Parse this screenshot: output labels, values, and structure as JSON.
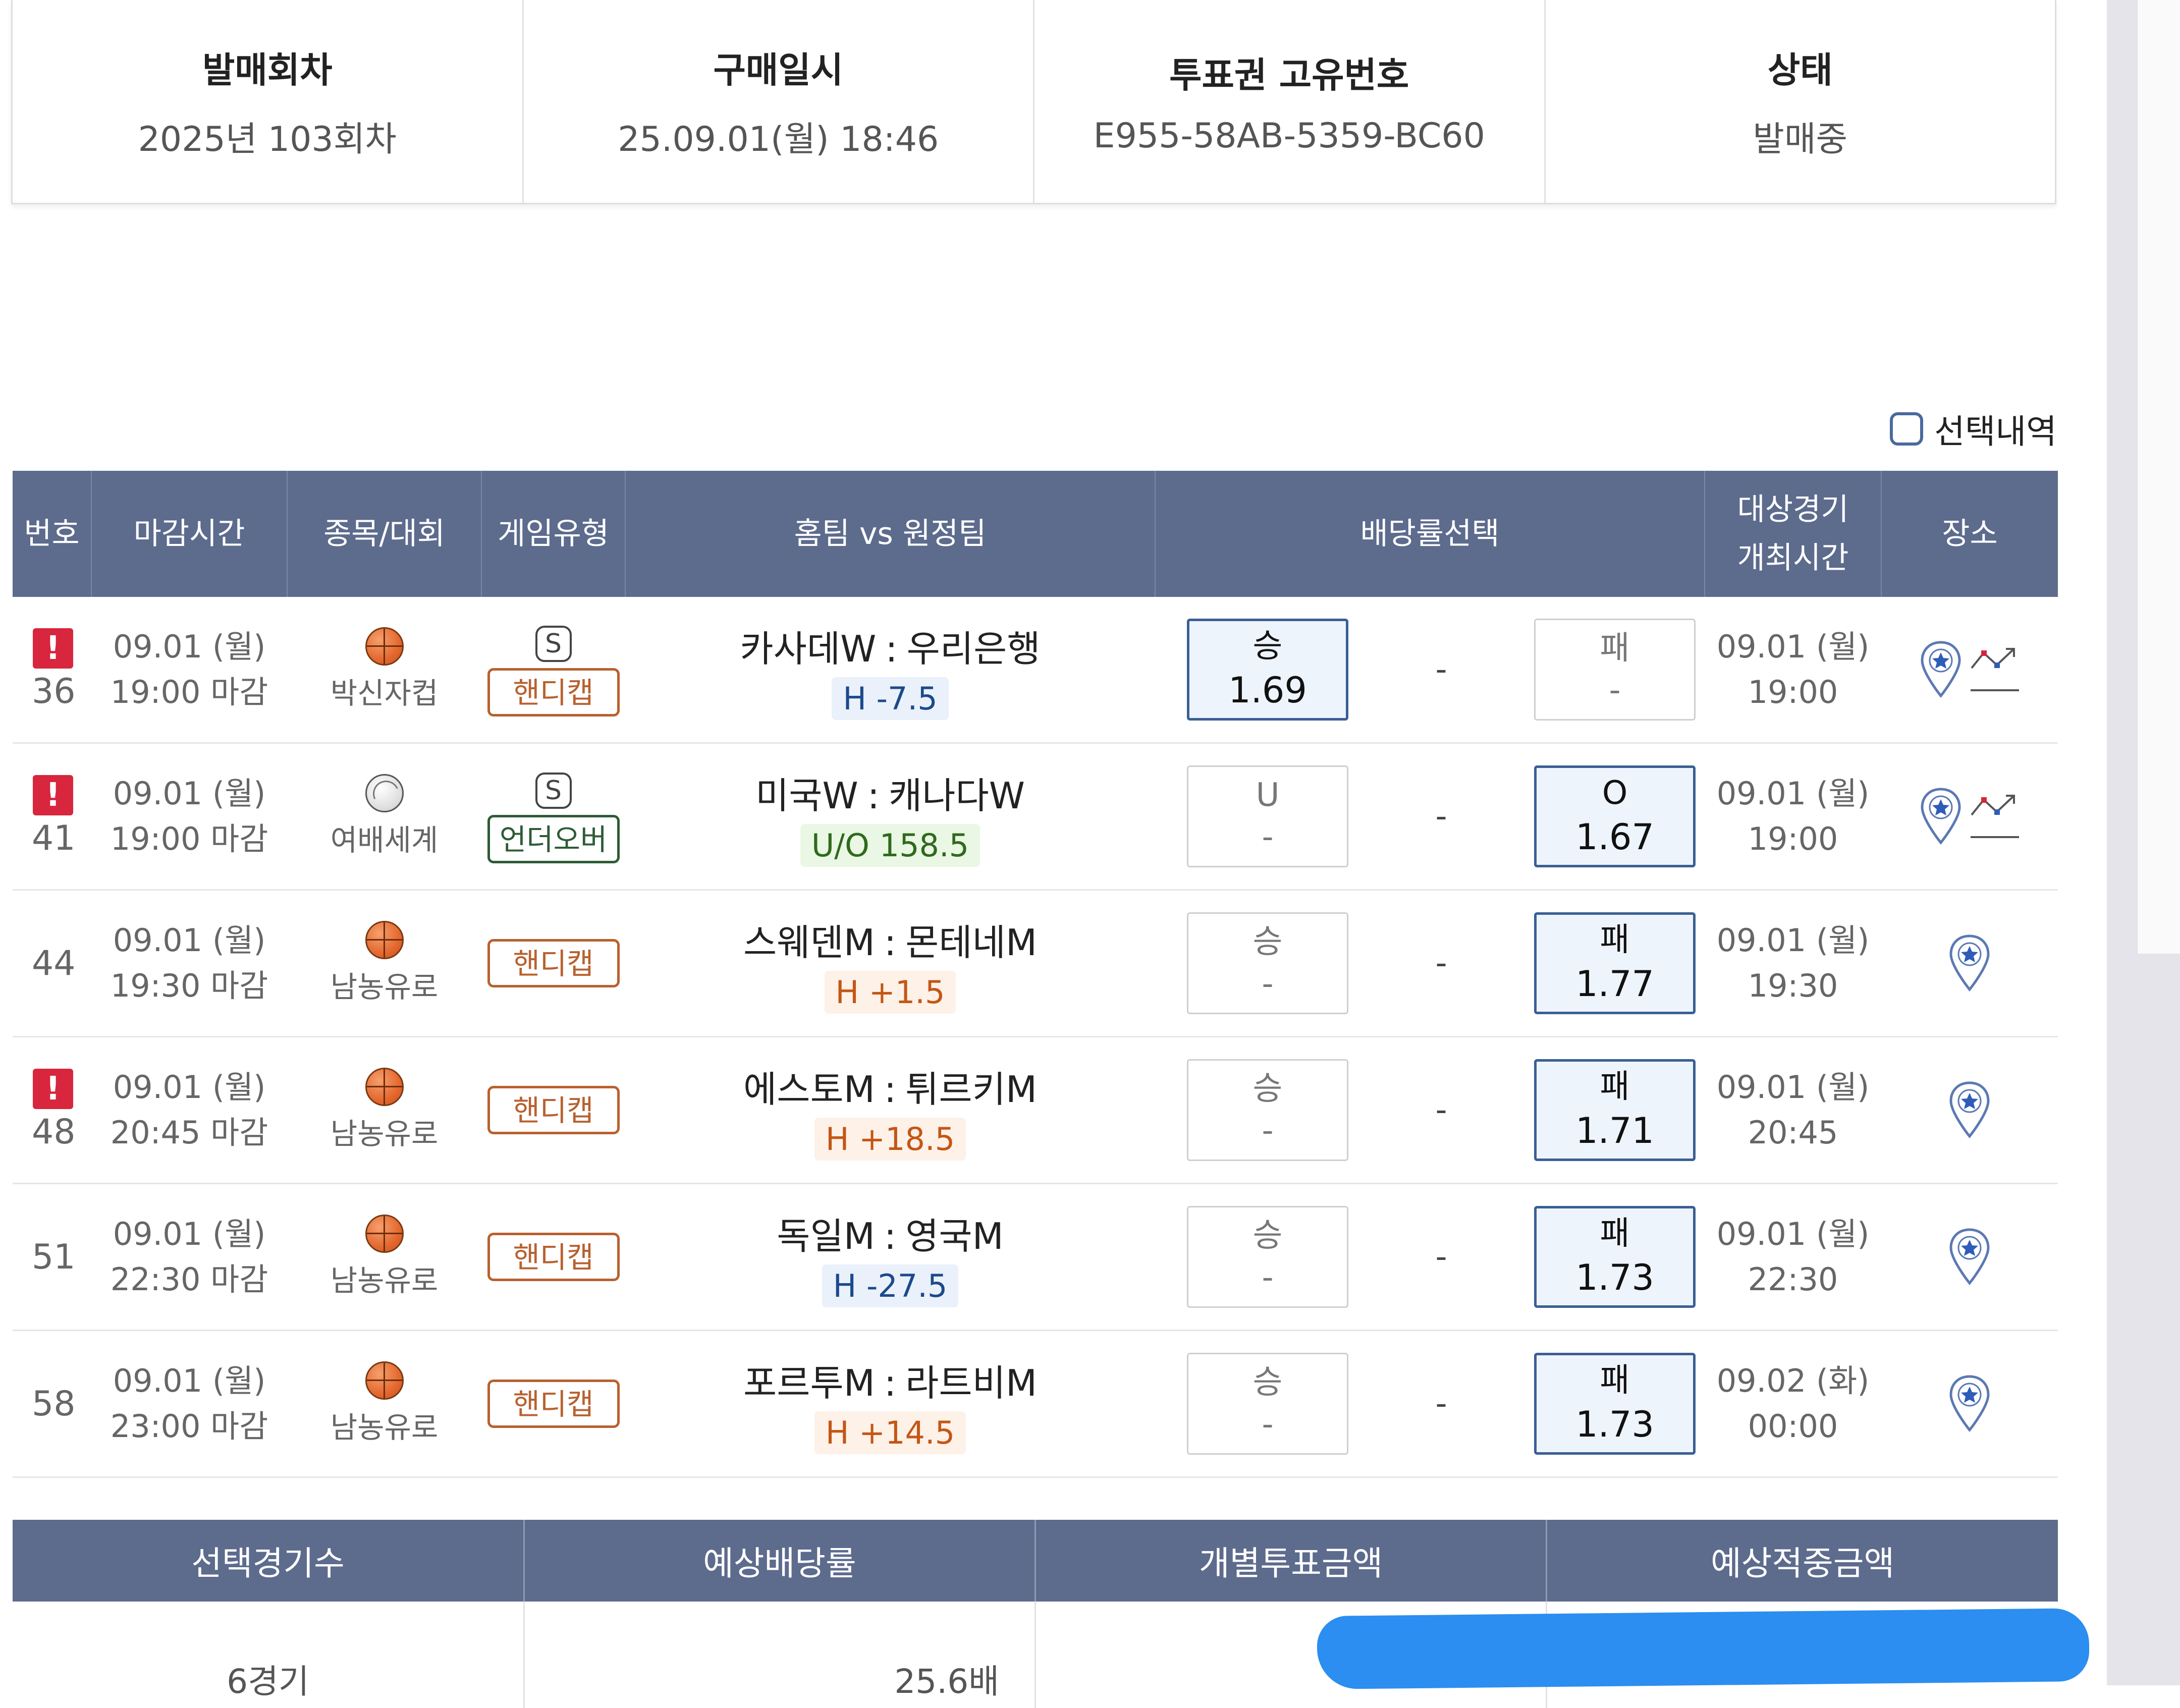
{
  "ticket_info": [
    {
      "label": "발매회차",
      "value": "2025년 103회차"
    },
    {
      "label": "구매일시",
      "value": "25.09.01(월) 18:46"
    },
    {
      "label": "투표권 고유번호",
      "value": "E955-58AB-5359-BC60"
    },
    {
      "label": "상태",
      "value": "발매중"
    }
  ],
  "selection_toggle": {
    "label": "선택내역"
  },
  "table": {
    "headers": {
      "no": "번호",
      "deadline": "마감시간",
      "sport": "종목/대회",
      "game_type": "게임유형",
      "teams": "홈팀 vs 원정팀",
      "odds": "배당률선택",
      "match_time_1": "대상경기",
      "match_time_2": "개최시간",
      "place": "장소"
    },
    "separator": ":",
    "odds_middle": "-",
    "rows": [
      {
        "alert": "!",
        "no": "36",
        "deadline_date": "09.01 (월)",
        "deadline_time": "19:00 마감",
        "sport_icon": "basketball-icon",
        "league": "박신자컵",
        "s_mark": "S",
        "game_type": "핸디캡",
        "game_type_color": "#b8612f",
        "home": "카사데W",
        "away": "우리은행",
        "line": "H -7.5",
        "line_style": "blue",
        "odd1_label": "승",
        "odd1_value": "1.69",
        "odd1_selected": true,
        "odd2_label": "패",
        "odd2_value": "-",
        "odd2_selected": false,
        "match_date": "09.01 (월)",
        "match_time": "19:00",
        "place_icons": [
          "map-pin-star-icon",
          "odds-trend-icon"
        ]
      },
      {
        "alert": "!",
        "no": "41",
        "deadline_date": "09.01 (월)",
        "deadline_time": "19:00 마감",
        "sport_icon": "volleyball-icon",
        "league": "여배세계",
        "s_mark": "S",
        "game_type": "언더오버",
        "game_type_color": "#2e5b36",
        "home": "미국W",
        "away": "캐나다W",
        "line": "U/O 158.5",
        "line_style": "green",
        "odd1_label": "U",
        "odd1_value": "-",
        "odd1_selected": false,
        "odd2_label": "O",
        "odd2_value": "1.67",
        "odd2_selected": true,
        "match_date": "09.01 (월)",
        "match_time": "19:00",
        "place_icons": [
          "map-pin-star-icon",
          "odds-trend-icon"
        ]
      },
      {
        "alert": "",
        "no": "44",
        "deadline_date": "09.01 (월)",
        "deadline_time": "19:30 마감",
        "sport_icon": "basketball-icon",
        "league": "남농유로",
        "s_mark": "",
        "game_type": "핸디캡",
        "game_type_color": "#b8612f",
        "home": "스웨덴M",
        "away": "몬테네M",
        "line": "H +1.5",
        "line_style": "orange",
        "odd1_label": "승",
        "odd1_value": "-",
        "odd1_selected": false,
        "odd2_label": "패",
        "odd2_value": "1.77",
        "odd2_selected": true,
        "match_date": "09.01 (월)",
        "match_time": "19:30",
        "place_icons": [
          "map-pin-star-icon"
        ]
      },
      {
        "alert": "!",
        "no": "48",
        "deadline_date": "09.01 (월)",
        "deadline_time": "20:45 마감",
        "sport_icon": "basketball-icon",
        "league": "남농유로",
        "s_mark": "",
        "game_type": "핸디캡",
        "game_type_color": "#b8612f",
        "home": "에스토M",
        "away": "튀르키M",
        "line": "H +18.5",
        "line_style": "orange",
        "odd1_label": "승",
        "odd1_value": "-",
        "odd1_selected": false,
        "odd2_label": "패",
        "odd2_value": "1.71",
        "odd2_selected": true,
        "match_date": "09.01 (월)",
        "match_time": "20:45",
        "place_icons": [
          "map-pin-star-icon"
        ]
      },
      {
        "alert": "",
        "no": "51",
        "deadline_date": "09.01 (월)",
        "deadline_time": "22:30 마감",
        "sport_icon": "basketball-icon",
        "league": "남농유로",
        "s_mark": "",
        "game_type": "핸디캡",
        "game_type_color": "#b8612f",
        "home": "독일M",
        "away": "영국M",
        "line": "H -27.5",
        "line_style": "blue",
        "odd1_label": "승",
        "odd1_value": "-",
        "odd1_selected": false,
        "odd2_label": "패",
        "odd2_value": "1.73",
        "odd2_selected": true,
        "match_date": "09.01 (월)",
        "match_time": "22:30",
        "place_icons": [
          "map-pin-star-icon"
        ]
      },
      {
        "alert": "",
        "no": "58",
        "deadline_date": "09.01 (월)",
        "deadline_time": "23:00 마감",
        "sport_icon": "basketball-icon",
        "league": "남농유로",
        "s_mark": "",
        "game_type": "핸디캡",
        "game_type_color": "#b8612f",
        "home": "포르투M",
        "away": "라트비M",
        "line": "H +14.5",
        "line_style": "orange",
        "odd1_label": "승",
        "odd1_value": "-",
        "odd1_selected": false,
        "odd2_label": "패",
        "odd2_value": "1.73",
        "odd2_selected": true,
        "match_date": "09.02 (화)",
        "match_time": "00:00",
        "place_icons": [
          "map-pin-star-icon"
        ]
      }
    ]
  },
  "summary": {
    "headers": [
      "선택경기수",
      "예상배당률",
      "개별투표금액",
      "예상적중금액"
    ],
    "values": [
      "6경기",
      "25.6배"
    ]
  },
  "colors": {
    "header_bg": "#5d6b8d",
    "selected_border": "#3a5f93",
    "alert_red": "#d7263d",
    "redaction_blue": "#2b8ef0"
  }
}
